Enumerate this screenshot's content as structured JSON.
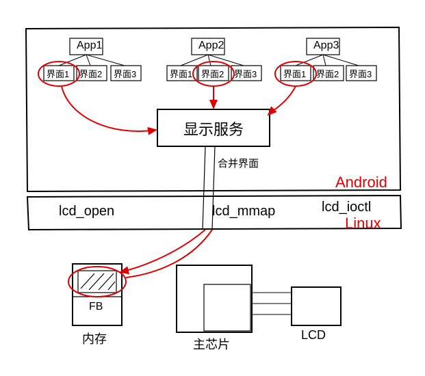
{
  "apps": [
    {
      "name": "App1",
      "surfaces": [
        "界面1",
        "界面2",
        "界面3"
      ]
    },
    {
      "name": "App2",
      "surfaces": [
        "界面1",
        "界面2",
        "界面3"
      ]
    },
    {
      "name": "App3",
      "surfaces": [
        "界面1",
        "界面2",
        "界面3"
      ]
    }
  ],
  "display_service": "显示服务",
  "merge_label": "合并界面",
  "syscalls": {
    "open": "lcd_open",
    "mmap": "lcd_mmap",
    "ioctl": "lcd_ioctl"
  },
  "layers": {
    "top": "Android",
    "bottom": "Linux"
  },
  "hardware": {
    "fb": "FB",
    "memory": "内存",
    "chip": "主芯片",
    "lcd": "LCD"
  },
  "red_circles": [
    "App1 界面1",
    "App2 界面2",
    "App3 界面1",
    "FB buffer"
  ],
  "arrows": [
    "App1.界面1 → 显示服务",
    "App2.界面2 → 显示服务",
    "App3.界面1 → 显示服务",
    "显示服务 → FB (via lcd_mmap)"
  ]
}
